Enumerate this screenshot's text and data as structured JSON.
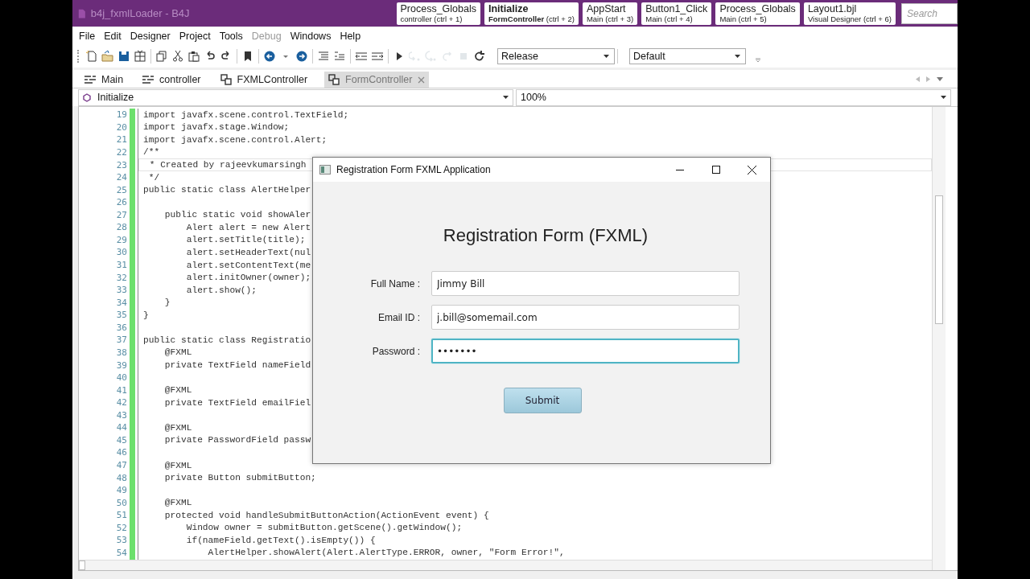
{
  "window": {
    "title": "b4j_fxmlLoader - B4J"
  },
  "quick_tabs": [
    {
      "title": "Process_Globals",
      "module": "controller",
      "shortcut": "(ctrl + 1)",
      "selected": false
    },
    {
      "title": "Initialize",
      "module": "FormController",
      "shortcut": "(ctrl + 2)",
      "selected": true
    },
    {
      "title": "AppStart",
      "module": "Main",
      "shortcut": "(ctrl + 3)",
      "selected": false
    },
    {
      "title": "Button1_Click",
      "module": "Main",
      "shortcut": "(ctrl + 4)",
      "selected": false
    },
    {
      "title": "Process_Globals",
      "module": "Main",
      "shortcut": "(ctrl + 5)",
      "selected": false
    },
    {
      "title": "Layout1.bjl",
      "module": "Visual Designer",
      "shortcut": "(ctrl + 6)",
      "selected": false
    }
  ],
  "search": {
    "placeholder": "Search"
  },
  "menu": [
    {
      "label": "File",
      "disabled": false
    },
    {
      "label": "Edit",
      "disabled": false
    },
    {
      "label": "Designer",
      "disabled": false
    },
    {
      "label": "Project",
      "disabled": false
    },
    {
      "label": "Tools",
      "disabled": false
    },
    {
      "label": "Debug",
      "disabled": true
    },
    {
      "label": "Windows",
      "disabled": false
    },
    {
      "label": "Help",
      "disabled": false
    }
  ],
  "toolbar": {
    "buttons": [
      {
        "disabled": false
      },
      {
        "disabled": false
      },
      {
        "disabled": false
      },
      {
        "disabled": false
      },
      {
        "disabled": false
      },
      {
        "disabled": false
      },
      {
        "disabled": false
      },
      {
        "disabled": false
      },
      {
        "disabled": false
      },
      {
        "disabled": false
      },
      {
        "disabled": false
      },
      {
        "disabled": false
      },
      {
        "disabled": false
      },
      {
        "disabled": false
      },
      {
        "disabled": false
      },
      {
        "disabled": false
      },
      {
        "disabled": false
      },
      {
        "disabled": false
      },
      {
        "disabled": true
      },
      {
        "disabled": true
      },
      {
        "disabled": true
      },
      {
        "disabled": true
      },
      {
        "disabled": false
      }
    ],
    "build_config": "Release",
    "profile": "Default"
  },
  "module_tabs": [
    {
      "label": "Main",
      "kind": "module",
      "selected": false
    },
    {
      "label": "controller",
      "kind": "module",
      "selected": false
    },
    {
      "label": "FXMLController",
      "kind": "class",
      "selected": false
    },
    {
      "label": "FormController",
      "kind": "class",
      "selected": true
    }
  ],
  "sub_dropdown": "Initialize",
  "zoom": "100%",
  "code": [
    {
      "num": "19",
      "text": "import javafx.scene.control.TextField;"
    },
    {
      "num": "20",
      "text": "import javafx.stage.Window;"
    },
    {
      "num": "21",
      "text": "import javafx.scene.control.Alert;"
    },
    {
      "num": "22",
      "text": "/**"
    },
    {
      "num": "23",
      "text": " * Created by rajeevkumarsingh",
      "current": true
    },
    {
      "num": "24",
      "text": " */"
    },
    {
      "num": "25",
      "text": "public static class AlertHelper"
    },
    {
      "num": "26"
    },
    {
      "num": "27",
      "text": "    public static void showAler"
    },
    {
      "num": "28",
      "text": "        Alert alert = new Alert"
    },
    {
      "num": "29",
      "text": "        alert.setTitle(title);"
    },
    {
      "num": "30",
      "text": "        alert.setHeaderText(nul"
    },
    {
      "num": "31",
      "text": "        alert.setContentText(me"
    },
    {
      "num": "32",
      "text": "        alert.initOwner(owner);"
    },
    {
      "num": "33",
      "text": "        alert.show();"
    },
    {
      "num": "34",
      "text": "    }"
    },
    {
      "num": "35",
      "text": "}"
    },
    {
      "num": "36"
    },
    {
      "num": "37",
      "text": "public static class Registratio"
    },
    {
      "num": "38",
      "text": "    @FXML"
    },
    {
      "num": "39",
      "text": "    private TextField nameField"
    },
    {
      "num": "40"
    },
    {
      "num": "41",
      "text": "    @FXML"
    },
    {
      "num": "42",
      "text": "    private TextField emailFiel"
    },
    {
      "num": "43"
    },
    {
      "num": "44",
      "text": "    @FXML"
    },
    {
      "num": "45",
      "text": "    private PasswordField passw"
    },
    {
      "num": "46"
    },
    {
      "num": "47",
      "text": "    @FXML"
    },
    {
      "num": "48",
      "text": "    private Button submitButton;"
    },
    {
      "num": "49"
    },
    {
      "num": "50",
      "text": "    @FXML"
    },
    {
      "num": "51",
      "text": "    protected void handleSubmitButtonAction(ActionEvent event) {"
    },
    {
      "num": "52",
      "text": "        Window owner = submitButton.getScene().getWindow();"
    },
    {
      "num": "53",
      "text": "        if(nameField.getText().isEmpty()) {"
    },
    {
      "num": "54",
      "text": "            AlertHelper.showAlert(Alert.AlertType.ERROR, owner, \"Form Error!\","
    }
  ],
  "dialog": {
    "title": "Registration Form FXML Application",
    "heading": "Registration Form (FXML)",
    "fields": [
      {
        "label": "Full Name :",
        "value": "Jimmy Bill",
        "focused": false
      },
      {
        "label": "Email ID :",
        "value": "j.bill@somemail.com",
        "focused": false
      },
      {
        "label": "Password :",
        "value": "•••••••",
        "focused": true
      }
    ],
    "submit": "Submit"
  }
}
